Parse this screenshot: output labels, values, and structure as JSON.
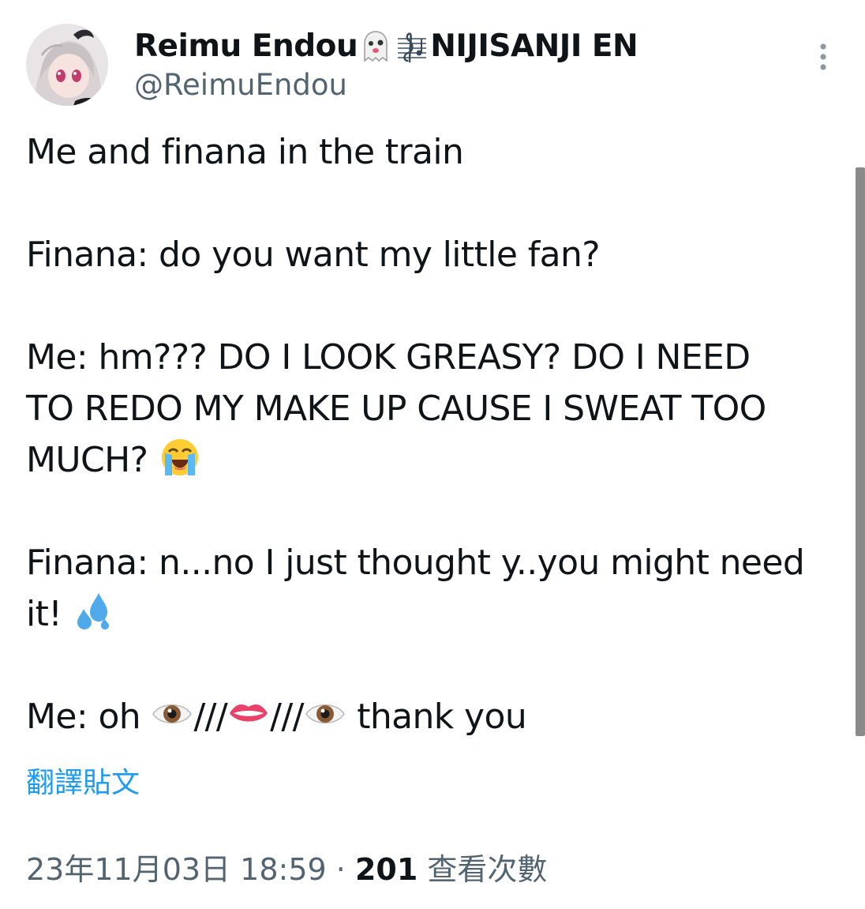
{
  "author": {
    "display_name_part1": "Reimu Endou",
    "display_name_part2": "NIJISANJI EN",
    "handle": "@ReimuEndou",
    "name_emojis": [
      "ghost-emoji",
      "music-score-emoji"
    ]
  },
  "tweet": {
    "paragraphs": [
      {
        "lines": [
          "Me and finana in the train"
        ]
      },
      {
        "lines": [
          "Finana: do you want my little fan?"
        ]
      },
      {
        "lines": [
          "Me: hm??? DO I LOOK GREASY? DO I NEED",
          "TO REDO MY MAKE UP CAUSE I SWEAT TOO",
          "MUCH?"
        ],
        "trailing_emoji": "loudly-crying-face-emoji"
      },
      {
        "lines": [
          "Finana: n...no I just thought y..you might need",
          "it!"
        ],
        "trailing_emoji": "sweat-droplets-emoji"
      },
      {
        "parts": [
          "Me: oh ",
          "///",
          "///",
          " thank you"
        ],
        "emojis": [
          "eye-emoji",
          "mouth-emoji",
          "eye-emoji"
        ]
      }
    ]
  },
  "translate_label": "翻譯貼文",
  "meta": {
    "date": "23年11月03日",
    "time": "18:59",
    "separator": "·",
    "views": "201",
    "views_label": "查看次數"
  },
  "colors": {
    "text": "#0f1419",
    "secondary": "#536471",
    "link": "#1d9bf0"
  }
}
